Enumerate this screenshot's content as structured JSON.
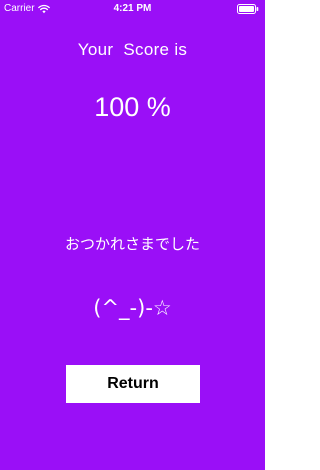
{
  "colors": {
    "background": "#9a0ff7",
    "text": "#ffffff",
    "button_background": "#ffffff",
    "button_text": "#000000"
  },
  "status_bar": {
    "carrier": "Carrier",
    "time": "4:21 PM",
    "wifi_icon": "wifi-icon",
    "battery_icon": "battery-icon"
  },
  "score": {
    "title": "Your  Score is",
    "value": "100 %"
  },
  "message": "おつかれさまでした",
  "emoticon": "(^_-)-☆",
  "return_button": {
    "label": "Return"
  }
}
